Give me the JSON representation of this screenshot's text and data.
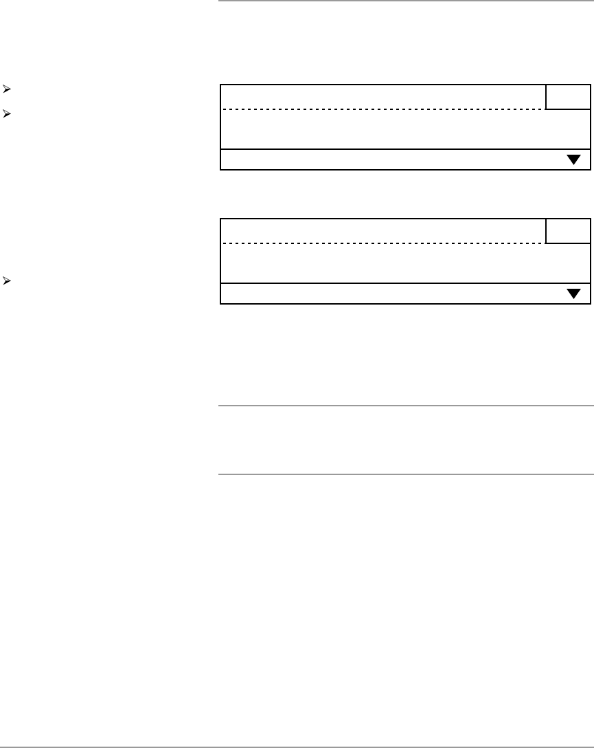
{
  "bullets": [
    {
      "kind": "arrow"
    },
    {
      "kind": "arrow"
    },
    {
      "kind": "arrow"
    }
  ],
  "panels": [
    {
      "kind": "dropdown-form"
    },
    {
      "kind": "dropdown-form"
    }
  ]
}
